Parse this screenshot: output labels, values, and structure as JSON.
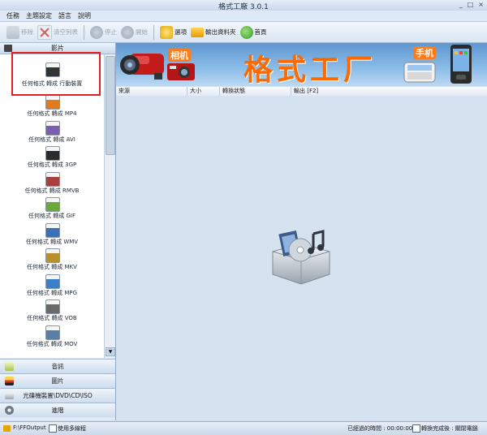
{
  "window": {
    "title": "格式工廠 3.0.1",
    "controls": [
      "_",
      "□",
      "×"
    ]
  },
  "menu": [
    "任務",
    "主題設定",
    "語言",
    "說明"
  ],
  "toolbar": {
    "remove": "移除",
    "clear_list": "清空列表",
    "stop": "停止",
    "start": "開始",
    "options": "選項",
    "output_folder": "輸出資料夾",
    "home": "首頁"
  },
  "sidebar": {
    "header": "影片",
    "formats": [
      "任何格式 轉成 行動裝置",
      "任何格式 轉成 MP4",
      "任何格式 轉成 AVI",
      "任何格式 轉成 3GP",
      "任何格式 轉成 RMVB",
      "任何格式 轉成 GIF",
      "任何格式 轉成 WMV",
      "任何格式 轉成 MKV",
      "任何格式 轉成 MPG",
      "任何格式 轉成 VOB",
      "任何格式 轉成 MOV"
    ],
    "format_badges": [
      "",
      "MP4",
      "AVI",
      "3GP",
      "RMVB",
      "GIF",
      "WMV",
      "MKV",
      "MPG",
      "VOB",
      "MOV"
    ],
    "categories": [
      "音訊",
      "圖片",
      "光碟機裝置\\DVD\\CD\\ISO",
      "進階"
    ]
  },
  "banner": {
    "brand": "格式工厂",
    "camera_tag": "相机",
    "phone_tag": "手机"
  },
  "table": {
    "columns": [
      "來源",
      "大小",
      "轉換狀態",
      "輸出 [F2]"
    ]
  },
  "status": {
    "output_path": "F:\\FFOutput",
    "multithread": "使用多線程",
    "elapsed": "已經過的時間 : 00:00:00",
    "after_done": "轉換完成後 : 關閉電腦"
  },
  "colors": {
    "accent": "#ff6a00",
    "highlight": "#e02020"
  }
}
